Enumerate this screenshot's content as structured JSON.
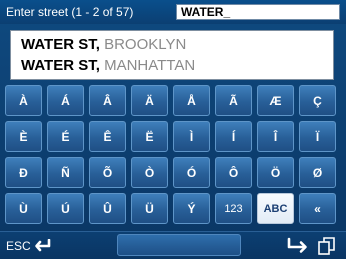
{
  "header": {
    "prompt": "Enter street (1 - 2 of 57)",
    "entry_value": "WATER_"
  },
  "results": [
    {
      "street": "WATER ST",
      "comma": ",",
      "city": " BROOKLYN"
    },
    {
      "street": "WATER ST",
      "comma": ",",
      "city": " MANHATTAN"
    }
  ],
  "keypad": {
    "rows": [
      [
        "À",
        "Á",
        "Â",
        "Ä",
        "Å",
        "Ã",
        "Æ",
        "Ç"
      ],
      [
        "È",
        "É",
        "Ê",
        "Ë",
        "Ì",
        "Í",
        "Î",
        "Ï"
      ],
      [
        "Ð",
        "Ñ",
        "Õ",
        "Ò",
        "Ó",
        "Ô",
        "Ö",
        "Ø"
      ],
      [
        "Ù",
        "Ú",
        "Û",
        "Ü",
        "Ý",
        "123",
        "ABC",
        "«"
      ]
    ],
    "active_mode": "ABC"
  },
  "footer": {
    "esc_label": "ESC",
    "icons": {
      "back": "back-arrow-icon",
      "ok": "enter-arrow-icon",
      "copy": "copy-icon"
    }
  },
  "colors": {
    "background": "#0f4a80",
    "key": "#2f6fa8",
    "active_key": "#eef4fa",
    "text": "#ffffff",
    "city_text": "#8a8a8a"
  }
}
